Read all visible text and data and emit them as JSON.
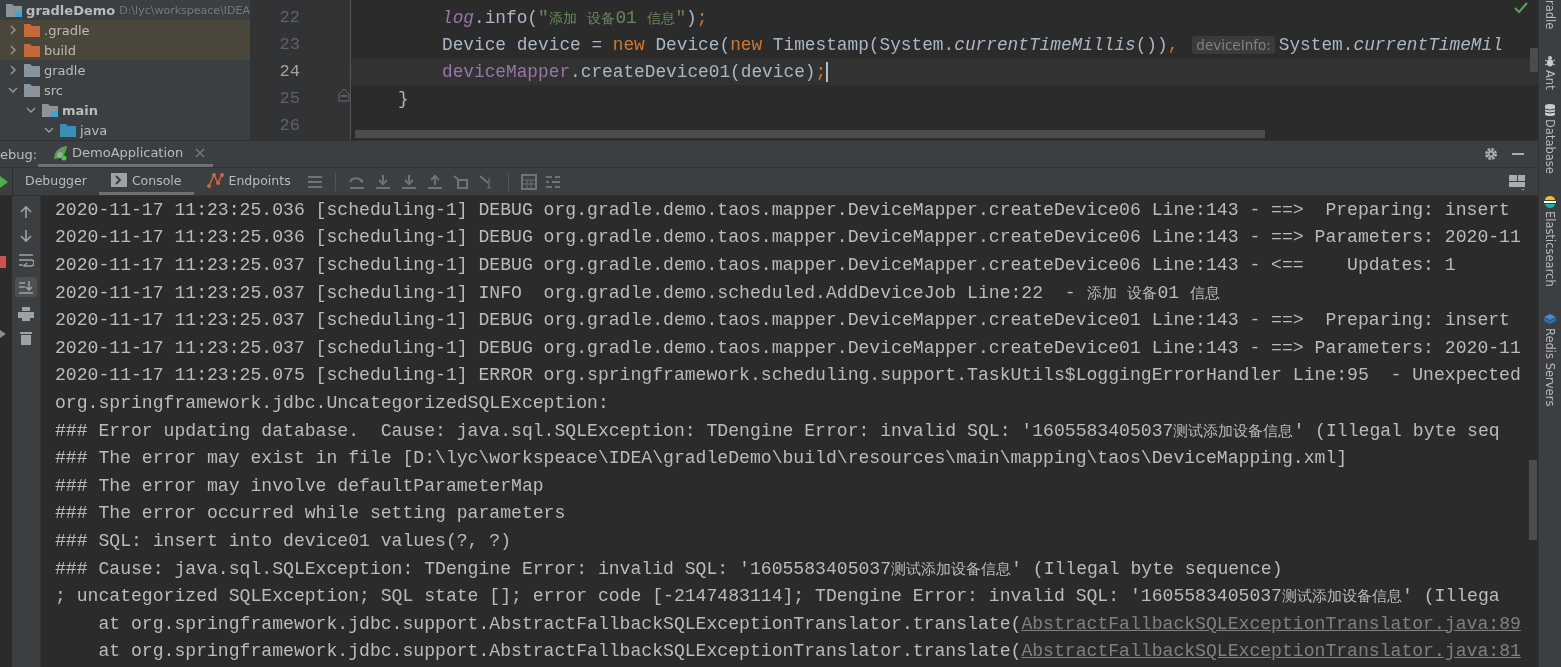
{
  "project_tree": {
    "root": {
      "name": "gradleDemo",
      "path": "D:\\lyc\\workspeace\\IDEA"
    },
    "items": [
      {
        "name": ".gradle",
        "kind": "excluded",
        "expanded": false
      },
      {
        "name": "build",
        "kind": "excluded",
        "expanded": false
      },
      {
        "name": "gradle",
        "kind": "plain",
        "expanded": false
      },
      {
        "name": "src",
        "kind": "plain",
        "expanded": true,
        "children": [
          {
            "name": "main",
            "kind": "module",
            "expanded": true,
            "children": [
              {
                "name": "java",
                "kind": "source",
                "expanded": true
              }
            ]
          }
        ]
      }
    ]
  },
  "editor": {
    "lines": [
      {
        "number": "22",
        "current": false,
        "kind": "statement",
        "tokens": [
          {
            "kind": "static",
            "text": "log"
          },
          {
            "kind": "plain",
            "text": ".info("
          },
          {
            "kind": "string",
            "text": "\"添加 设备01 信息\""
          },
          {
            "kind": "plain",
            "text": ")"
          },
          {
            "kind": "keyword",
            "text": ";"
          }
        ]
      },
      {
        "number": "23",
        "current": false,
        "kind": "statement",
        "tokens": [
          {
            "kind": "plain",
            "text": "Device device = "
          },
          {
            "kind": "keyword",
            "text": "new"
          },
          {
            "kind": "plain",
            "text": " Device("
          },
          {
            "kind": "keyword",
            "text": "new"
          },
          {
            "kind": "plain",
            "text": " Timestamp(System."
          },
          {
            "kind": "italic",
            "text": "currentTimeMillis"
          },
          {
            "kind": "plain",
            "text": "())"
          },
          {
            "kind": "keyword",
            "text": ","
          },
          {
            "kind": "hint",
            "text": "deviceInfo:"
          },
          {
            "kind": "plain",
            "text": "System."
          },
          {
            "kind": "italic",
            "text": "currentTimeMil"
          }
        ]
      },
      {
        "number": "24",
        "current": true,
        "kind": "statement",
        "tokens": [
          {
            "kind": "field",
            "text": "deviceMapper"
          },
          {
            "kind": "plain",
            "text": ".createDevice01(device)"
          },
          {
            "kind": "keyword",
            "text": ";"
          }
        ]
      },
      {
        "number": "25",
        "current": false,
        "kind": "block-end",
        "tokens": [
          {
            "kind": "plain",
            "text": "}"
          }
        ]
      },
      {
        "number": "26",
        "current": false,
        "kind": "blank"
      }
    ]
  },
  "debug_panel": {
    "label": "ebug:",
    "sessions": [
      {
        "label": "DemoApplication",
        "selected": true
      }
    ],
    "tabs": [
      {
        "label": "Debugger",
        "kind": "debugger",
        "selected": false
      },
      {
        "label": "Console",
        "kind": "console",
        "selected": true
      },
      {
        "label": "Endpoints",
        "kind": "endpoints",
        "selected": false
      }
    ]
  },
  "console": {
    "scroll_to_end_on": true,
    "lines": [
      {
        "text": "2020-11-17 11:23:25.036 [scheduling-1] DEBUG org.gradle.demo.taos.mapper.DeviceMapper.createDevice06 Line:143 - ==>  Preparing: insert"
      },
      {
        "text": "2020-11-17 11:23:25.036 [scheduling-1] DEBUG org.gradle.demo.taos.mapper.DeviceMapper.createDevice06 Line:143 - ==> Parameters: 2020-11"
      },
      {
        "text": "2020-11-17 11:23:25.037 [scheduling-1] DEBUG org.gradle.demo.taos.mapper.DeviceMapper.createDevice06 Line:143 - <==    Updates: 1"
      },
      {
        "text": "2020-11-17 11:23:25.037 [scheduling-1] INFO  org.gradle.demo.scheduled.AddDeviceJob Line:22  - 添加 设备01 信息"
      },
      {
        "text": "2020-11-17 11:23:25.037 [scheduling-1] DEBUG org.gradle.demo.taos.mapper.DeviceMapper.createDevice01 Line:143 - ==>  Preparing: insert"
      },
      {
        "text": "2020-11-17 11:23:25.037 [scheduling-1] DEBUG org.gradle.demo.taos.mapper.DeviceMapper.createDevice01 Line:143 - ==> Parameters: 2020-11"
      },
      {
        "text": "2020-11-17 11:23:25.075 [scheduling-1] ERROR org.springframework.scheduling.support.TaskUtils$LoggingErrorHandler Line:95  - Unexpected"
      },
      {
        "text": "org.springframework.jdbc.UncategorizedSQLException:"
      },
      {
        "text": "### Error updating database.  Cause: java.sql.SQLException: TDengine Error: invalid SQL: '1605583405037测试添加设备信息' (Illegal byte seq"
      },
      {
        "text": "### The error may exist in file [D:\\lyc\\workspeace\\IDEA\\gradleDemo\\build\\resources\\main\\mapping\\taos\\DeviceMapping.xml]"
      },
      {
        "text": "### The error may involve defaultParameterMap"
      },
      {
        "text": "### The error occurred while setting parameters"
      },
      {
        "text": "### SQL: insert into device01 values(?, ?)"
      },
      {
        "text": "### Cause: java.sql.SQLException: TDengine Error: invalid SQL: '1605583405037测试添加设备信息' (Illegal byte sequence)"
      },
      {
        "text": "; uncategorized SQLException; SQL state []; error code [-2147483114]; TDengine Error: invalid SQL: '1605583405037测试添加设备信息' (Illega"
      },
      {
        "text": "    at org.springframework.jdbc.support.AbstractFallbackSQLExceptionTranslator.translate(",
        "link": "AbstractFallbackSQLExceptionTranslator.java:89"
      },
      {
        "text": "    at org.springframework.jdbc.support.AbstractFallbackSQLExceptionTranslator.translate(",
        "link": "AbstractFallbackSQLExceptionTranslator.java:81"
      }
    ]
  },
  "tool_windows": [
    {
      "label": "radle",
      "kind": "gradle"
    },
    {
      "label": "Ant",
      "kind": "ant"
    },
    {
      "label": "Database",
      "kind": "database"
    },
    {
      "label": "Elasticsearch",
      "kind": "elasticsearch"
    },
    {
      "label": "Redis Servers",
      "kind": "redis"
    }
  ]
}
